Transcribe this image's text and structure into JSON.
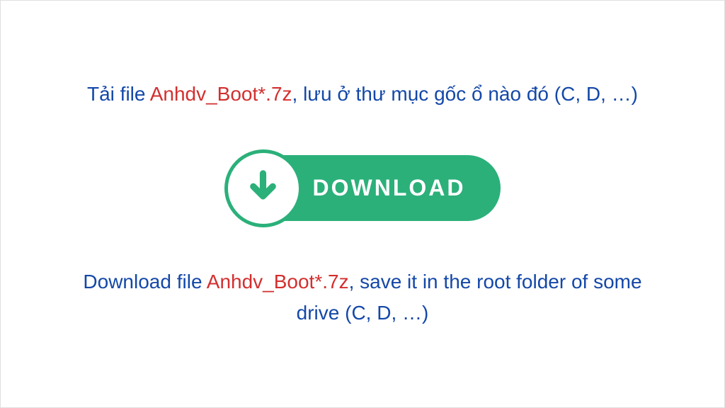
{
  "instruction_vi": {
    "prefix": "Tải file ",
    "filename": "Anhdv_Boot*.7z",
    "suffix": ", lưu ở thư mục gốc ổ nào đó (C, D, …)"
  },
  "instruction_en": {
    "prefix": "Download file ",
    "filename": "Anhdv_Boot*.7z",
    "suffix": ", save it in the root folder of some drive (C, D, …)"
  },
  "button": {
    "label": "DOWNLOAD"
  },
  "colors": {
    "text_blue": "#1448a8",
    "text_red": "#d32f2f",
    "button_green": "#2bb07a"
  }
}
